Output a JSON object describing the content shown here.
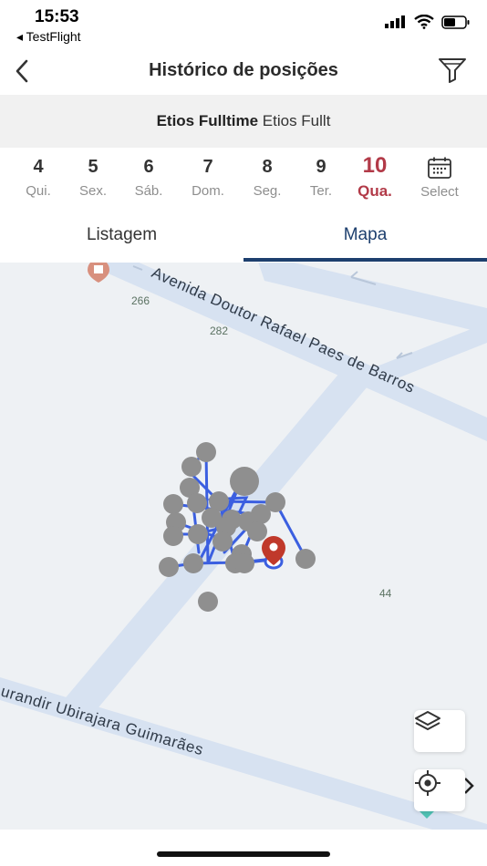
{
  "status_bar": {
    "time": "15:53",
    "back_app": "◂ TestFlight"
  },
  "header": {
    "title": "Histórico de posições"
  },
  "vehicle": {
    "name_bold": "Etios Fulltime",
    "name_regular": "Etios Fullt"
  },
  "days": [
    {
      "num": "4",
      "weekday": "Qui."
    },
    {
      "num": "5",
      "weekday": "Sex."
    },
    {
      "num": "6",
      "weekday": "Sáb."
    },
    {
      "num": "7",
      "weekday": "Dom."
    },
    {
      "num": "8",
      "weekday": "Seg."
    },
    {
      "num": "9",
      "weekday": "Ter."
    },
    {
      "num": "10",
      "weekday": "Qua.",
      "active": true
    },
    {
      "icon": "calendar-icon",
      "weekday": "Select"
    }
  ],
  "tabs": {
    "list": "Listagem",
    "map": "Mapa",
    "selected": "map"
  },
  "map": {
    "street_1": "Avenida Doutor Rafael Paes de Barros",
    "street_2": "urandir Ubirajara Guimarães",
    "numbers": [
      "266",
      "282",
      "44"
    ],
    "route_color": "#3b5fe0",
    "marker_color": "#c0392b",
    "position_color": "#8f8f8f"
  },
  "colors": {
    "accent": "#1d3f6e",
    "active_day": "#b23a48",
    "road": "#d7e2f1"
  }
}
